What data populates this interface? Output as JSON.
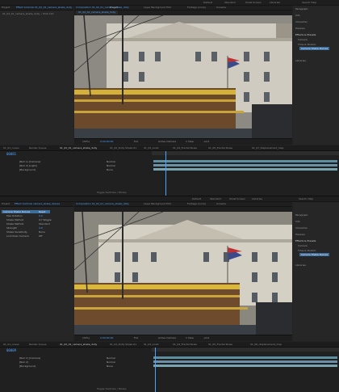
{
  "top": {
    "menu": [
      "Default",
      "Standard",
      "Small Screen",
      "Libraries",
      "Search Help"
    ],
    "left_panel_tabs": [
      "Project",
      "Effect Controls 01_02_01_camera_shake_dolly"
    ],
    "left_panel_subtitle": "01_02_01_camera_shake_dolly • Shot 120",
    "viewer_tabs": [
      "Composition 01_02_01_camera_shake_dolly",
      "Layer Background Plot",
      "Footage (none)",
      "Console"
    ],
    "viewer_subtab": "01_02_01_camera_shake_dolly",
    "viewer_title": "Project",
    "viewer_footer": [
      "(34%)",
      "0:00:00:00",
      "Full",
      "Active Camera",
      "1 View",
      "+0.0"
    ],
    "right_panel": {
      "items": [
        "Paragraph",
        "Info",
        "Character",
        "Preview",
        "Effects & Presets",
        "Camera",
        "Time & Stretch"
      ],
      "selected": "Camera Shake Deluxe",
      "footer": "Libraries"
    },
    "tl_tabs": [
      "01_01_ocean",
      "Render Queue",
      "01_02_01_camera_shake_dolly",
      "01_02_Dolly Shake 01",
      "01_03_Lootz",
      "01_04_Fractal Noise",
      "01_05_Fractal Noise",
      "01_07_Displacement_map"
    ],
    "timecode": "00081",
    "layers": [
      "[Null 1] [Camera]",
      "[Null 2] [Light]",
      "[Background]"
    ],
    "layer_modes": [
      "Normal",
      "Normal",
      "None"
    ],
    "status": "Toggle Switches / Modes"
  },
  "bottom": {
    "menu": [
      "Default",
      "Standard",
      "Small Screen",
      "Libraries",
      "Search Help"
    ],
    "left_panel_tabs": [
      "Project",
      "Effect Controls camera_shake_deluxe"
    ],
    "props": [
      [
        "Camera Shake Deluxe",
        "Reset"
      ],
      [
        "Max Rotation",
        "0.0"
      ],
      [
        "Shake Method",
        "X-Y Wiggle"
      ],
      [
        "Shake Method",
        "Standard"
      ],
      [
        "Strength",
        "4.0"
      ],
      [
        "Shake Sensitivity",
        "None"
      ],
      [
        "Lockdown Camera",
        "Off"
      ]
    ],
    "viewer_tabs": [
      "Composition 01_02_01_camera_shake_dolly",
      "Layer Background Plot",
      "Footage (none)",
      "Console"
    ],
    "viewer_footer": [
      "(34%)",
      "0:00:00:00",
      "Full",
      "Active Camera",
      "1 View",
      "+0.0"
    ],
    "right_panel": {
      "items": [
        "Paragraph",
        "Info",
        "Character",
        "Preview",
        "Effects & Presets",
        "Camera",
        "Time & Stretch"
      ],
      "selected": "Camera Shake Deluxe",
      "footer": "Libraries"
    },
    "tl_tabs": [
      "01_01_ocean",
      "Render Queue",
      "01_02_01_camera_shake_dolly",
      "01_02_Dolly Shake 01",
      "01_03_Lootz",
      "01_04_Fractal Noise",
      "01_05_Fractal Noise",
      "01_06_displacement_map"
    ],
    "timecode": "00009",
    "layers": [
      "[Null 1] [Camera]",
      "[Null 2]",
      "[Background]"
    ],
    "layer_modes": [
      "Normal",
      "Normal",
      "None"
    ],
    "status": "Toggle Switches / Modes"
  }
}
